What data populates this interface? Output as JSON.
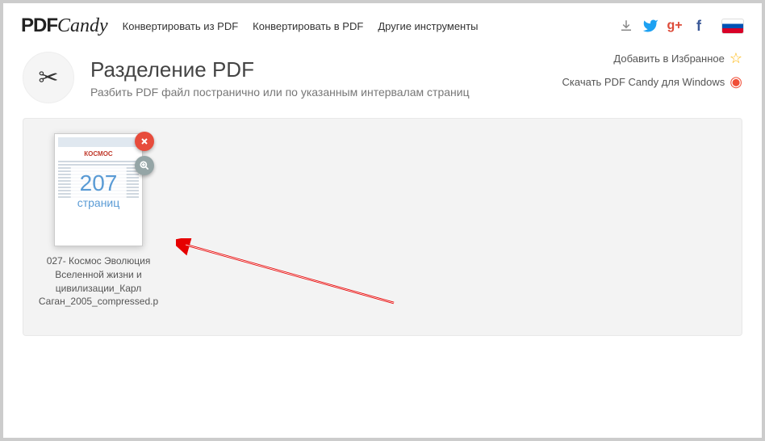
{
  "header": {
    "logo_pdf": "PDF",
    "logo_candy": "Candy",
    "nav": {
      "convert_from": "Конвертировать из PDF",
      "convert_to": "Конвертировать в PDF",
      "other_tools": "Другие инструменты"
    },
    "social": {
      "download": "↓",
      "twitter": "🐦",
      "gplus": "g+",
      "facebook": "f"
    }
  },
  "top_links": {
    "favorite": "Добавить в Избранное",
    "download_win": "Скачать PDF Candy для Windows"
  },
  "tool": {
    "title": "Разделение PDF",
    "subtitle": "Разбить PDF файл постранично или по указанным интервалам страниц"
  },
  "file": {
    "thumb_title": "КОСМОС",
    "page_count": "207",
    "page_label": "страниц",
    "name": "027- Космос Эволюция Вселенной жизни и цивилизации_Карл Саган_2005_compressed.p"
  }
}
